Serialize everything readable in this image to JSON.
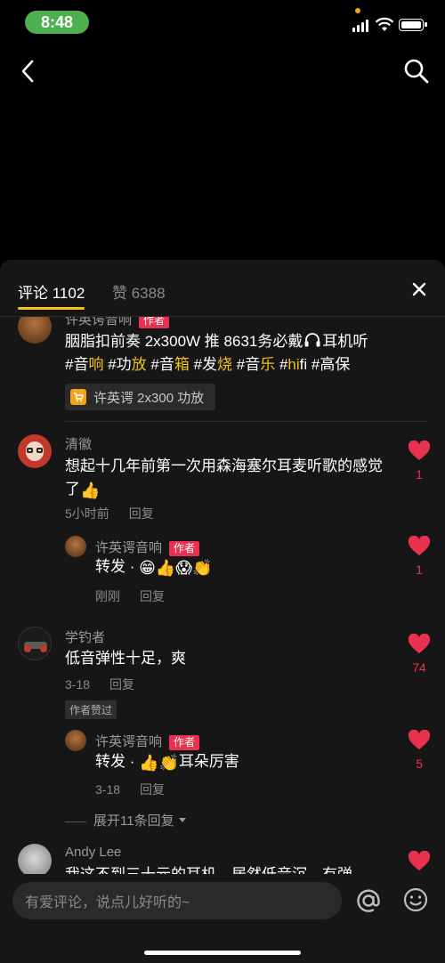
{
  "status": {
    "time": "8:48"
  },
  "tabs": {
    "comments": "评论 1102",
    "likes": "赞 6388"
  },
  "comments": [
    {
      "name": "许英谔音响",
      "tag": "作者",
      "text_plain": "胭脂扣前奏 2x300W 推 8631务必戴",
      "text_after_icon": "耳机听",
      "hashtags": [
        {
          "hash": "#音",
          "hl": "响"
        },
        {
          "hash": " #功",
          "hl": "放"
        },
        {
          "hash": " #音",
          "hl": "箱"
        },
        {
          "hash": " #发",
          "hl": "烧"
        },
        {
          "hash": " #音",
          "hl": "乐"
        },
        {
          "hash": " #",
          "hl": "hi",
          "rest": "fi"
        },
        {
          "hash": " #高保",
          "hl": ""
        }
      ],
      "product": "许英谔 2x300 功放"
    },
    {
      "name": "清徽",
      "text": "想起十几年前第一次用森海塞尔耳麦听歌的感觉了",
      "emoji": "👍",
      "time": "5小时前",
      "reply": "回复",
      "likes": "1"
    },
    {
      "name": "许英谔音响",
      "tag": "作者",
      "text": "转发 · ",
      "emojis": "😁👍😱👏",
      "time": "刚刚",
      "reply": "回复",
      "likes": "1"
    },
    {
      "name": "学钓者",
      "text": "低音弹性十足，爽",
      "time": "3-18",
      "reply": "回复",
      "likes": "74",
      "author_liked": "作者赞过"
    },
    {
      "name": "许英谔音响",
      "tag": "作者",
      "text": "转发 · ",
      "emojis": "👍👏",
      "text_after": "耳朵厉害",
      "time": "3-18",
      "reply": "回复",
      "likes": "5"
    },
    {
      "name": "Andy Lee",
      "text": "我这不到三十元的耳机，居然低音沉，有弹"
    }
  ],
  "expand": "展开11条回复",
  "input": {
    "placeholder": "有爱评论，说点儿好听的~"
  },
  "colors": {
    "accent": "#f1c40f",
    "like": "#e8304f",
    "background": "#161616"
  }
}
